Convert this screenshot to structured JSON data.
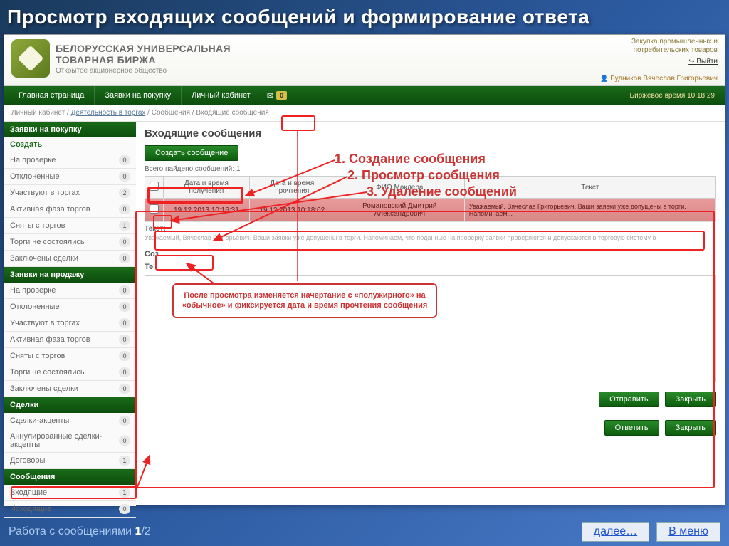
{
  "slide_title": "Просмотр входящих сообщений и формирование ответа",
  "logo": {
    "line1": "БЕЛОРУССКАЯ УНИВЕРСАЛЬНАЯ",
    "line2": "ТОВАРНАЯ БИРЖА",
    "line3": "Открытое акционерное общество"
  },
  "header": {
    "tagline1": "Закупка промышленных и",
    "tagline2": "потребительских товаров",
    "exit": "Выйти",
    "user": "Будников Вячеслав Григорьевич"
  },
  "nav": {
    "items": [
      "Главная страница",
      "Заявки на покупку",
      "Личный кабинет"
    ],
    "mail_badge": "0",
    "time_label": "Биржевое время 10:18:29"
  },
  "breadcrumb": {
    "p1": "Личный кабинет",
    "p2": "Деятельность в торгах",
    "p3": "Сообщения",
    "p4": "Входящие сообщения"
  },
  "sidebar": {
    "groups": [
      {
        "title": "Заявки на покупку",
        "items": [
          {
            "label": "Создать",
            "count": null,
            "create": true
          },
          {
            "label": "На проверке",
            "count": "0"
          },
          {
            "label": "Отклоненные",
            "count": "0"
          },
          {
            "label": "Участвуют в торгах",
            "count": "2"
          },
          {
            "label": "Активная фаза торгов",
            "count": "0"
          },
          {
            "label": "Сняты с торгов",
            "count": "1"
          },
          {
            "label": "Торги не состоялись",
            "count": "0"
          },
          {
            "label": "Заключены сделки",
            "count": "0"
          }
        ]
      },
      {
        "title": "Заявки на продажу",
        "items": [
          {
            "label": "На проверке",
            "count": "0"
          },
          {
            "label": "Отклоненные",
            "count": "0"
          },
          {
            "label": "Участвуют в торгах",
            "count": "0"
          },
          {
            "label": "Активная фаза торгов",
            "count": "0"
          },
          {
            "label": "Сняты с торгов",
            "count": "0"
          },
          {
            "label": "Торги не состоялись",
            "count": "0"
          },
          {
            "label": "Заключены сделки",
            "count": "0"
          }
        ]
      },
      {
        "title": "Сделки",
        "items": [
          {
            "label": "Сделки-акцепты",
            "count": "0"
          },
          {
            "label": "Аннулированные сделки-акцепты",
            "count": "0"
          },
          {
            "label": "Договоры",
            "count": "1"
          }
        ]
      },
      {
        "title": "Сообщения",
        "items": [
          {
            "label": "Входящие",
            "count": "1"
          },
          {
            "label": "Исходящие",
            "count": "0"
          }
        ]
      }
    ]
  },
  "main": {
    "title": "Входящие сообщения",
    "create_btn": "Создать сообщение",
    "count_text": "Всего найдено сообщений: 1",
    "headers": [
      "",
      "Дата и время получения",
      "Дата и время прочтения",
      "ФИО Маклера",
      "Текст"
    ],
    "row": {
      "dt_recv": "19.12.2013 10:16:31",
      "dt_read": "19.12.2013 10:18:02",
      "fio": "Романовский Дмитрий Александрович",
      "text": "Уважаемый, Вячеслав Григорьевич. Ваши заявки уже допущены в торги. Напоминаем..."
    },
    "text_label": "Текст:",
    "text_preview": "Уважаемый, Вячеслав Григорьевич. Ваши заявки уже допущены в торги. Напоминаем, что поданные на проверку заявки проверяются и допускаются в торговую систему в",
    "compose_title": "Соз",
    "compose_label": "Те",
    "btn_send": "Отправить",
    "btn_close": "Закрыть",
    "btn_reply": "Ответить",
    "btn_close2": "Закрыть"
  },
  "annotations": {
    "t1": "1. Создание сообщения",
    "t2": "2. Просмотр сообщения",
    "t3": "3. Удаление сообщений",
    "callout": "После просмотра изменяется начертание с «полужирного» на «обычное» и фиксируется дата и время прочтения сообщения"
  },
  "footer": {
    "step_text": "Работа с сообщениями",
    "step_cur": "1",
    "step_total": "/2",
    "next": "далее…",
    "menu": "В меню"
  }
}
